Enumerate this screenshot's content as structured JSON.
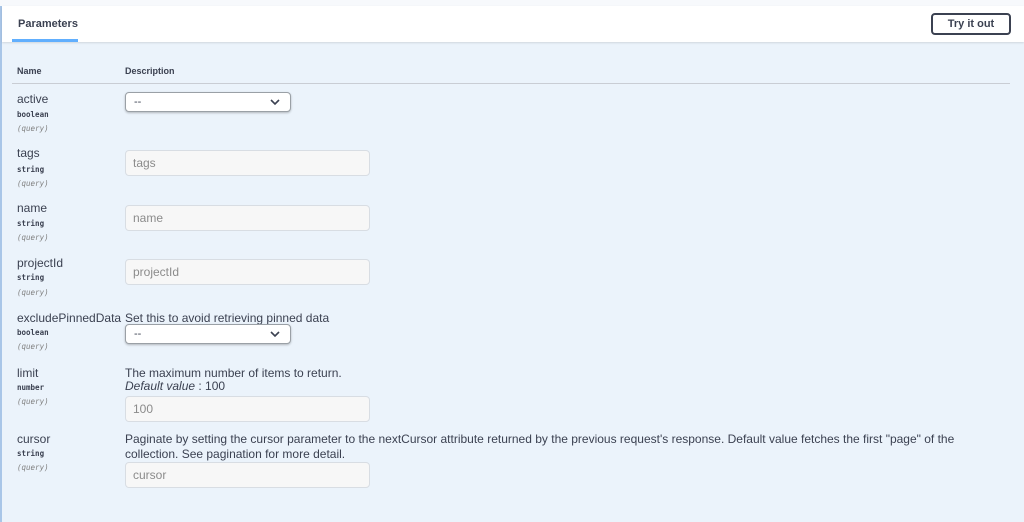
{
  "header": {
    "tab_label": "Parameters",
    "try_button_label": "Try it out"
  },
  "columns": {
    "name": "Name",
    "description": "Description"
  },
  "params": {
    "active": {
      "name": "active",
      "type": "boolean",
      "in": "(query)",
      "select_value": "--"
    },
    "tags": {
      "name": "tags",
      "type": "string",
      "in": "(query)",
      "placeholder": "tags"
    },
    "name": {
      "name": "name",
      "type": "string",
      "in": "(query)",
      "placeholder": "name"
    },
    "projectId": {
      "name": "projectId",
      "type": "string",
      "in": "(query)",
      "placeholder": "projectId"
    },
    "excludePinnedData": {
      "name": "excludePinnedData",
      "type": "boolean",
      "in": "(query)",
      "description": "Set this to avoid retrieving pinned data",
      "select_value": "--"
    },
    "limit": {
      "name": "limit",
      "type": "number",
      "in": "(query)",
      "description": "The maximum number of items to return.",
      "default_label": "Default value",
      "default_sep": " : 100",
      "placeholder": "100"
    },
    "cursor": {
      "name": "cursor",
      "type": "string",
      "in": "(query)",
      "description": "Paginate by setting the cursor parameter to the nextCursor attribute returned by the previous request's response. Default value fetches the first \"page\" of the collection. See pagination for more detail.",
      "placeholder": "cursor"
    }
  },
  "icons": {
    "select_arrow": "chevron-down-icon"
  },
  "colors": {
    "tab_underline": "#61affe",
    "background": "#ebf3fb"
  }
}
